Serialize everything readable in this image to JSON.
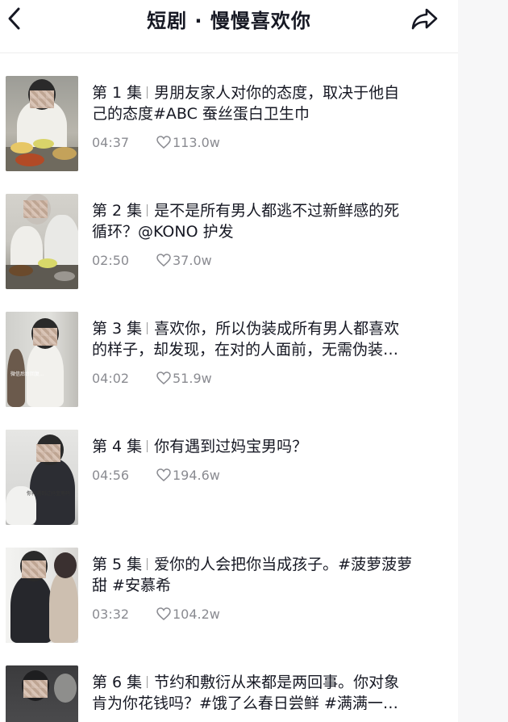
{
  "header": {
    "title": "短剧 · 慢慢喜欢你",
    "back_icon": "chevron-left-icon",
    "share_icon": "share-arrow-icon"
  },
  "episodes": [
    {
      "num": "第 1 集",
      "title_line1": "男朋友家人对你的态度，取决于他自",
      "title_line2": "己的态度#ABC 蚕丝蛋白卫生巾",
      "duration": "04:37",
      "likes": "113.0w"
    },
    {
      "num": "第 2 集",
      "title_line1": "是不是所有男人都逃不过新鲜感的死",
      "title_line2": "循环？@KONO 护发",
      "duration": "02:50",
      "likes": "37.0w"
    },
    {
      "num": "第 3 集",
      "title_line1": "喜欢你，所以伪装成所有男人都喜欢",
      "title_line2": "的样子，却发现，在对的人面前，无需伪装…",
      "duration": "04:02",
      "likes": "51.9w"
    },
    {
      "num": "第 4 集",
      "title_line1": "你有遇到过妈宝男吗？",
      "title_line2": "",
      "duration": "04:56",
      "likes": "194.6w"
    },
    {
      "num": "第 5 集",
      "title_line1": "爱你的人会把你当成孩子。#菠萝菠萝",
      "title_line2": "甜 #安慕希",
      "duration": "03:32",
      "likes": "104.2w"
    },
    {
      "num": "第 6 集",
      "title_line1": "节约和敷衍从来都是两回事。你对象",
      "title_line2": "肯为你花钱吗？#饿了么春日尝鲜 #满满一…",
      "duration": "",
      "likes": ""
    }
  ],
  "colors": {
    "text": "#161823",
    "meta": "#8a8b91",
    "divider": "#ededed"
  }
}
